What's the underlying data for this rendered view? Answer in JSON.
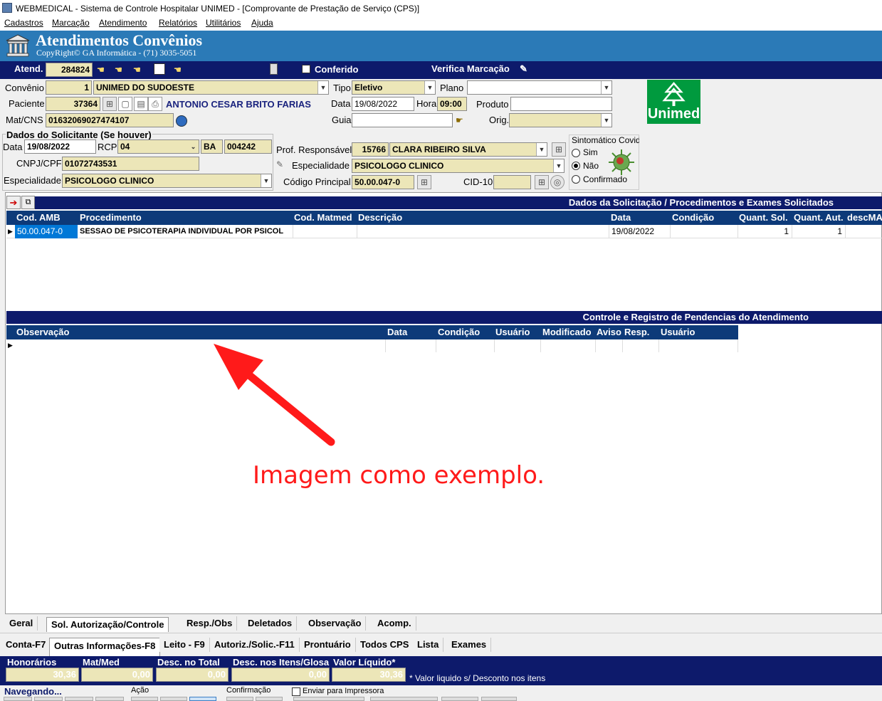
{
  "window": {
    "title": "WEBMEDICAL - Sistema de Controle Hospitalar UNIMED - [Comprovante de Prestação de Serviço  (CPS)]"
  },
  "menu": [
    "Cadastros",
    "Marcação",
    "Atendimento",
    "Relatórios",
    "Utilitários",
    "Ajuda"
  ],
  "banner": {
    "title": "Atendimentos Convênios",
    "copyright": "CopyRight© GA Informática - (71) 3035-5051"
  },
  "toolbar": {
    "atend_label": "Atend.",
    "atend_value": "284824",
    "conferido_label": "Conferido",
    "verifica_label": "Verifica Marcação"
  },
  "form": {
    "convenio_label": "Convênio",
    "convenio_code": "1",
    "convenio_name": "UNIMED DO SUDOESTE",
    "tipo_label": "Tipo",
    "tipo_value": "Eletivo",
    "plano_label": "Plano",
    "plano_value": "",
    "paciente_label": "Paciente",
    "paciente_code": "37364",
    "paciente_name": "ANTONIO CESAR BRITO FARIAS",
    "data_label": "Data",
    "data_value": "19/08/2022",
    "hora_label": "Hora",
    "hora_value": "09:00",
    "produto_label": "Produto",
    "produto_value": "",
    "matcns_label": "Mat/CNS",
    "matcns_value": "01632069027474107",
    "guia_label": "Guia",
    "guia_value": "",
    "orig_label": "Orig.",
    "orig_value": ""
  },
  "solicitante": {
    "section_label": "Dados do Solicitante (Se houver)",
    "data_label": "Data",
    "data_value": "19/08/2022",
    "rcp_label": "RCP",
    "rcp_value": "04",
    "uf_value": "BA",
    "number_value": "004242",
    "cnpj_label": "CNPJ/CPF",
    "cnpj_value": "01072743531",
    "especialidade_label": "Especialidade",
    "especialidade_value": "PSICOLOGO CLINICO"
  },
  "profissional": {
    "prof_label": "Prof. Responsável",
    "prof_code": "15766",
    "prof_name": "CLARA RIBEIRO SILVA",
    "especialidade_label": "Especialidade",
    "especialidade_value": "PSICOLOGO CLINICO",
    "codigo_label": "Código Principal",
    "codigo_value": "50.00.047-0",
    "cid_label": "CID-10",
    "cid_value": ""
  },
  "covid": {
    "label": "Sintomático Covid",
    "options": [
      "Sim",
      "Não",
      "Confirmado"
    ],
    "selected": "Não"
  },
  "logo": {
    "text": "Unimed",
    "color": "#009a3e"
  },
  "procedures": {
    "section_title": "Dados da Solicitação / Procedimentos e Exames Solicitados",
    "columns": [
      "Cod. AMB",
      "Procedimento",
      "Cod. Matmed",
      "Descrição",
      "Data",
      "Condição",
      "Quant. Sol.",
      "Quant. Aut.",
      "descMA"
    ],
    "rows": [
      {
        "cod_amb": "50.00.047-0",
        "procedimento": "SESSAO DE PSICOTERAPIA INDIVIDUAL POR PSICOL",
        "cod_matmed": "",
        "descricao": "",
        "data": "19/08/2022",
        "condicao": "",
        "quant_sol": "1",
        "quant_aut": "1"
      }
    ]
  },
  "pendencias": {
    "section_title": "Controle e Registro de Pendencias do Atendimento",
    "columns": [
      "Observação",
      "Data",
      "Condição",
      "Usuário",
      "Modificado",
      "Aviso",
      "Resp.",
      "Usuário"
    ]
  },
  "annotation": {
    "text": "Imagem como exemplo.",
    "color": "#ff0000"
  },
  "tabs_row1": [
    "Geral",
    "Sol. Autorização/Controle",
    "Resp./Obs",
    "Deletados",
    "Observação",
    "Acomp."
  ],
  "tabs_row1_selected": "Sol. Autorização/Controle",
  "tabs_row2": [
    "Conta-F7",
    "Outras Informações-F8",
    "Leito - F9",
    "Autoriz./Solic.-F11",
    "Prontuário",
    "Todos CPS",
    "Lista",
    "Exames"
  ],
  "tabs_row2_selected": "Outras Informações-F8",
  "totals": {
    "honorarios_label": "Honorários",
    "honorarios_value": "30,36",
    "matmed_label": "Mat/Med",
    "matmed_value": "0,00",
    "desc_total_label": "Desc. no Total",
    "desc_total_value": "0,00",
    "desc_itens_label": "Desc. nos Itens/Glosa",
    "desc_itens_value": "0,00",
    "liquido_label": "Valor Líquido*",
    "liquido_value": "30,36",
    "note": "* Valor liquido s/ Desconto nos itens"
  },
  "status": {
    "navegando": "Navegando...",
    "acao": "Ação",
    "confirmacao": "Confirmação",
    "enviar": "Enviar para Impressora"
  }
}
